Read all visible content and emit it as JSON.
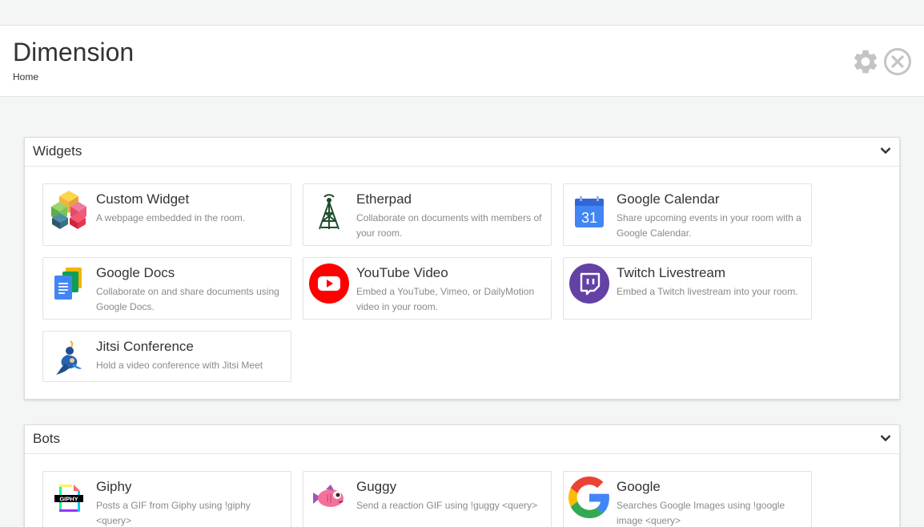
{
  "header": {
    "title": "Dimension",
    "breadcrumb": "Home"
  },
  "sections": {
    "widgets": {
      "title": "Widgets",
      "items": [
        {
          "name": "Custom Widget",
          "description": "A webpage embedded in the room.",
          "icon": "custom-widget-icon"
        },
        {
          "name": "Etherpad",
          "description": "Collaborate on documents with members of your room.",
          "icon": "etherpad-icon"
        },
        {
          "name": "Google Calendar",
          "description": "Share upcoming events in your room with a Google Calendar.",
          "icon": "google-calendar-icon"
        },
        {
          "name": "Google Docs",
          "description": "Collaborate on and share documents using Google Docs.",
          "icon": "google-docs-icon"
        },
        {
          "name": "YouTube Video",
          "description": "Embed a YouTube, Vimeo, or DailyMotion video in your room.",
          "icon": "youtube-icon"
        },
        {
          "name": "Twitch Livestream",
          "description": "Embed a Twitch livestream into your room.",
          "icon": "twitch-icon"
        },
        {
          "name": "Jitsi Conference",
          "description": "Hold a video conference with Jitsi Meet",
          "icon": "jitsi-icon"
        }
      ]
    },
    "bots": {
      "title": "Bots",
      "items": [
        {
          "name": "Giphy",
          "description": "Posts a GIF from Giphy using !giphy <query>",
          "icon": "giphy-icon"
        },
        {
          "name": "Guggy",
          "description": "Send a reaction GIF using !guggy <query>",
          "icon": "guggy-icon"
        },
        {
          "name": "Google",
          "description": "Searches Google Images using !google image <query>",
          "icon": "google-icon"
        }
      ]
    }
  },
  "icons": {
    "calendar_day": "31",
    "giphy_text": "GIPHY"
  },
  "colors": {
    "youtube": "#ff0000",
    "twitch": "#6441a4",
    "calendar": "#4285f4",
    "docs": "#4285f4",
    "header_icon": "#c4c4c4"
  }
}
